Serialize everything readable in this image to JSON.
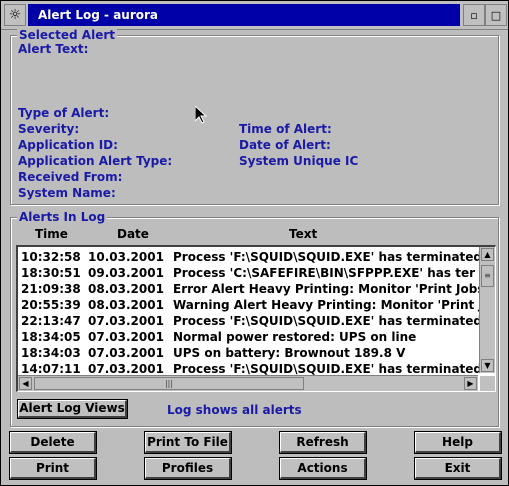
{
  "window": {
    "title": "Alert Log - aurora",
    "sysmenu_icon": "gear-icon",
    "minimize_icon": "minimize-icon",
    "maximize_icon": "maximize-icon"
  },
  "selected_alert": {
    "group_label": "Selected Alert",
    "alert_text_label": "Alert Text:",
    "type_label": "Type of Alert:",
    "severity_label": "Severity:",
    "app_id_label": "Application ID:",
    "app_alert_type_label": "Application Alert Type:",
    "received_from_label": "Received From:",
    "system_name_label": "System Name:",
    "time_label": "Time of Alert:",
    "date_label": "Date of Alert:",
    "system_unique_label": "System Unique IC"
  },
  "alerts_in_log": {
    "group_label": "Alerts In Log",
    "columns": [
      "Time",
      "Date",
      "Text"
    ],
    "rows": [
      {
        "time": "10:32:58",
        "date": "10.03.2001",
        "text": "Process 'F:\\SQUID\\SQUID.EXE' has terminated."
      },
      {
        "time": "18:30:51",
        "date": "09.03.2001",
        "text": "Process 'C:\\SAFEFIRE\\BIN\\SFPPP.EXE' has ter"
      },
      {
        "time": "21:09:38",
        "date": "08.03.2001",
        "text": "Error Alert Heavy Printing: Monitor 'Print Jobs ("
      },
      {
        "time": "20:55:39",
        "date": "08.03.2001",
        "text": "Warning Alert Heavy Printing: Monitor 'Print Jol"
      },
      {
        "time": "22:13:47",
        "date": "07.03.2001",
        "text": "Process 'F:\\SQUID\\SQUID.EXE' has terminated."
      },
      {
        "time": "18:34:05",
        "date": "07.03.2001",
        "text": "Normal power restored: UPS on line"
      },
      {
        "time": "18:34:03",
        "date": "07.03.2001",
        "text": "UPS on battery: Brownout 189.8 V"
      },
      {
        "time": "14:07:11",
        "date": "07.03.2001",
        "text": "Process 'F:\\SQUID\\SQUID.EXE' has terminated."
      }
    ]
  },
  "view_button": "Alert Log Views",
  "status_text": "Log shows all alerts",
  "buttons": {
    "delete": "Delete",
    "print_to_file": "Print To File",
    "refresh": "Refresh",
    "help": "Help",
    "print": "Print",
    "profiles": "Profiles",
    "actions": "Actions",
    "exit": "Exit"
  },
  "colors": {
    "title_bar": "#0000a8",
    "label_blue": "#1a1aa6",
    "window_bg": "#bdbdbd"
  }
}
